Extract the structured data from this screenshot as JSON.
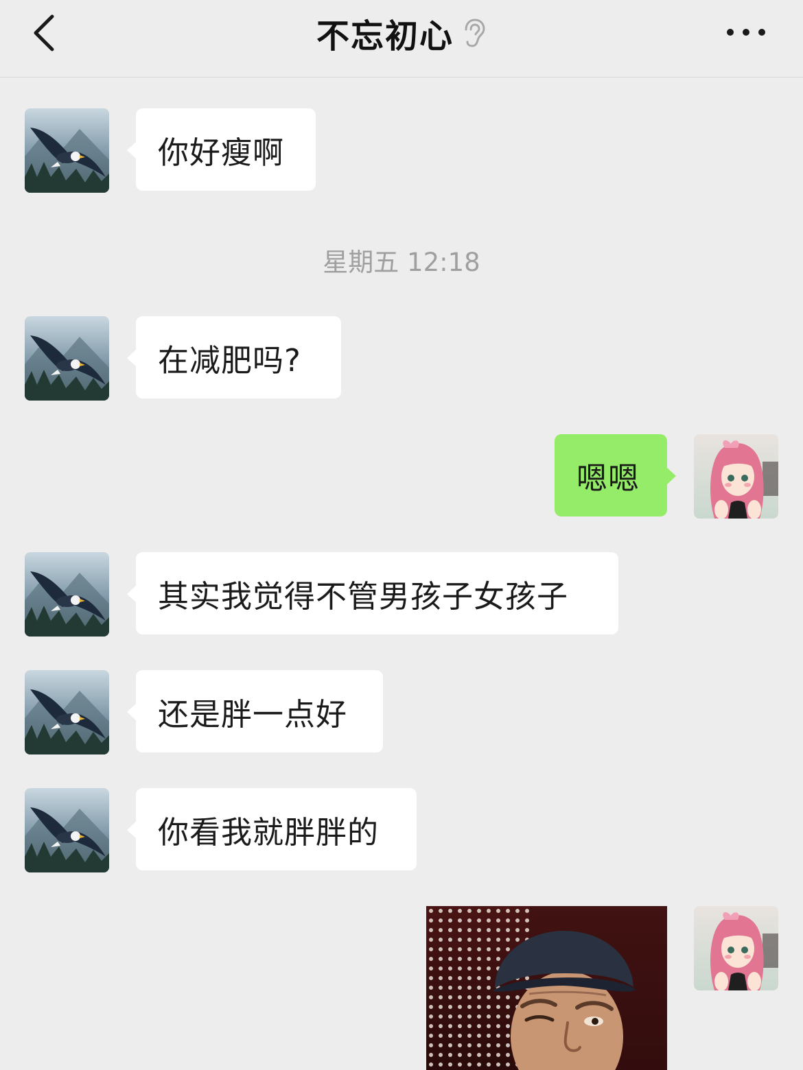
{
  "header": {
    "title": "不忘初心",
    "back_icon": "chevron-left-icon",
    "ear_icon": "ear-icon",
    "more_icon": "more-dots-icon"
  },
  "timestamp": "星期五 12:18",
  "messages": [
    {
      "side": "incoming",
      "text": "你好瘦啊"
    },
    {
      "side": "incoming",
      "text": "在减肥吗?"
    },
    {
      "side": "outgoing",
      "text": "嗯嗯"
    },
    {
      "side": "incoming",
      "text": "其实我觉得不管男孩子女孩子"
    },
    {
      "side": "incoming",
      "text": "还是胖一点好"
    },
    {
      "side": "incoming",
      "text": "你看我就胖胖的"
    },
    {
      "side": "outgoing",
      "type": "sticker",
      "sticker": "man-in-cap-squinting-sticker"
    }
  ],
  "colors": {
    "background": "#ededed",
    "incoming_bubble": "#ffffff",
    "outgoing_bubble": "#95ec69",
    "timestamp_text": "#9f9f9f"
  }
}
